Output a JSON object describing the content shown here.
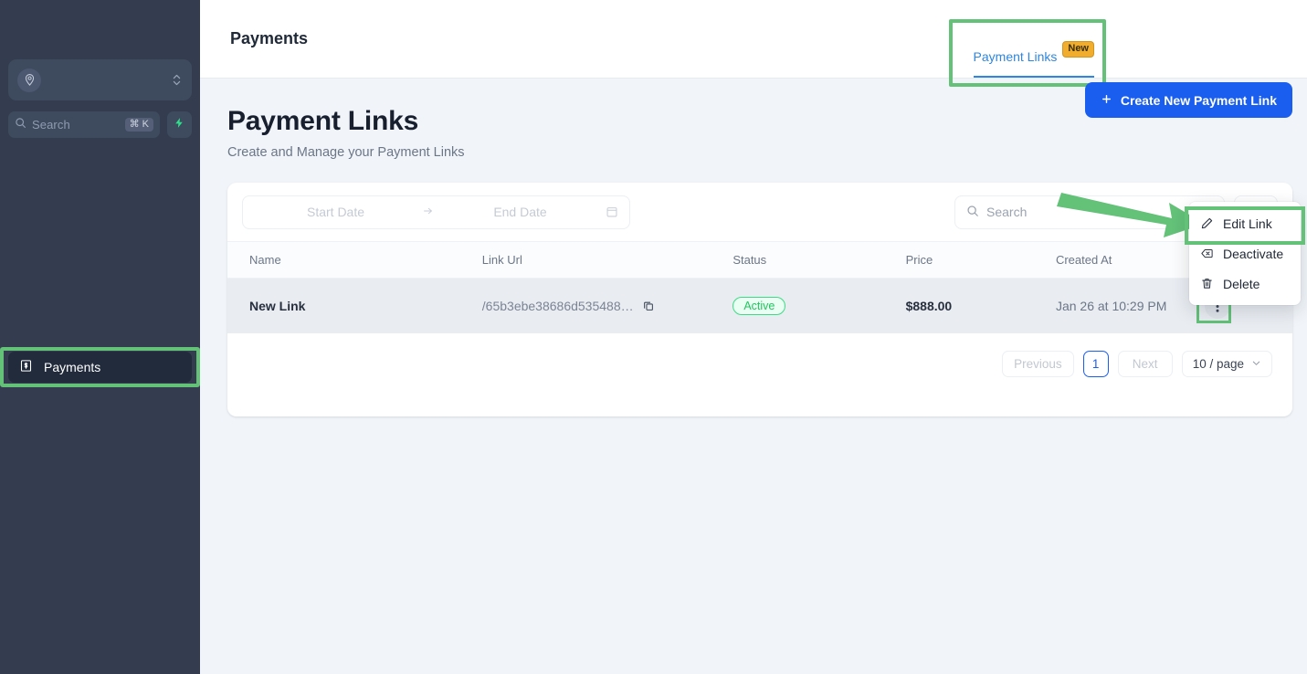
{
  "sidebar": {
    "org_switcher": {
      "icon": "user-pin-icon",
      "expand_icon": "chevron-up-down-icon"
    },
    "search": {
      "placeholder": "Search",
      "shortcut": "⌘ K",
      "icon": "search-icon"
    },
    "bolt_button": {
      "icon": "lightning-bolt-icon"
    },
    "items": [
      {
        "label": "Payments",
        "icon": "banknote-icon",
        "active": true,
        "highlighted": true
      }
    ]
  },
  "header": {
    "title": "Payments",
    "tabs": [
      {
        "label": "Payment Links",
        "badge": "New",
        "active": true,
        "highlighted": true
      }
    ]
  },
  "page": {
    "title": "Payment Links",
    "subtitle": "Create and Manage your Payment Links",
    "create_button": {
      "label": "Create New Payment Link",
      "icon": "plus-icon"
    }
  },
  "filters": {
    "date_range": {
      "start_placeholder": "Start Date",
      "end_placeholder": "End Date",
      "separator_icon": "arrow-right-icon",
      "calendar_icon": "calendar-icon"
    },
    "search": {
      "placeholder": "Search",
      "value": "",
      "icon": "search-icon"
    },
    "filter_button": {
      "icon": "filter-icon"
    }
  },
  "table": {
    "columns": [
      "Name",
      "Link Url",
      "Status",
      "Price",
      "Created At",
      ""
    ],
    "rows": [
      {
        "name": "New Link",
        "link_url": "/65b3ebe38686d535488…",
        "copy_icon": "copy-icon",
        "status": "Active",
        "price": "$888.00",
        "created_at": "Jan 26 at 10:29 PM",
        "actions_icon": "more-vertical-icon"
      }
    ]
  },
  "pagination": {
    "previous_label": "Previous",
    "current_page": "1",
    "next_label": "Next",
    "page_size_label": "10 / page",
    "page_size_icon": "chevron-down-icon"
  },
  "context_menu": {
    "items": [
      {
        "label": "Edit Link",
        "icon": "pencil-icon",
        "highlighted": true
      },
      {
        "label": "Deactivate",
        "icon": "deactivate-x-icon",
        "highlighted": false
      },
      {
        "label": "Delete",
        "icon": "trash-icon",
        "highlighted": false
      }
    ]
  },
  "annotations": {
    "arrow_color": "#63c178",
    "highlight_color": "#63c178"
  },
  "colors": {
    "sidebar_bg": "#333d4f",
    "accent_blue": "#1a5ef0",
    "tab_blue": "#2e86de",
    "badge_new_bg": "#f0ad2e",
    "status_active": "#22c55e",
    "page_bg": "#f1f5f9"
  }
}
